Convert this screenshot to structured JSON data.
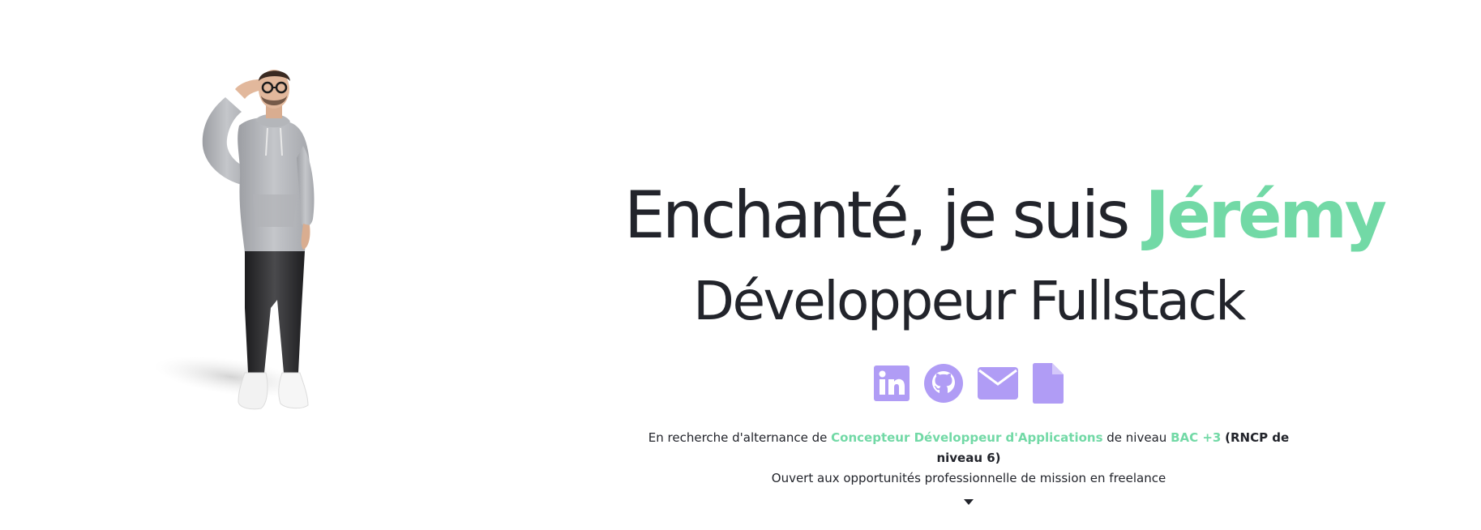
{
  "hero": {
    "headline_prefix": "Enchanté, je suis ",
    "headline_name": "Jérémy",
    "subtitle": "Développeur Fullstack"
  },
  "socials": [
    {
      "name": "linkedin-icon"
    },
    {
      "name": "github-icon"
    },
    {
      "name": "email-icon"
    },
    {
      "name": "document-icon"
    }
  ],
  "tagline": {
    "line1_part1": "En recherche d'alternance de",
    "line1_highlight1": "Concepteur Développeur d'Applications",
    "line1_part2": "de niveau",
    "line1_highlight2": "BAC +3",
    "line1_strong": "(RNCP de niveau 6)",
    "line2": "Ouvert aux opportunités professionnelle de mission en freelance"
  },
  "colors": {
    "accent_green": "#72d9a6",
    "icon_purple": "#b09cf5",
    "text_dark": "#22242b",
    "background": "#ffffff"
  }
}
